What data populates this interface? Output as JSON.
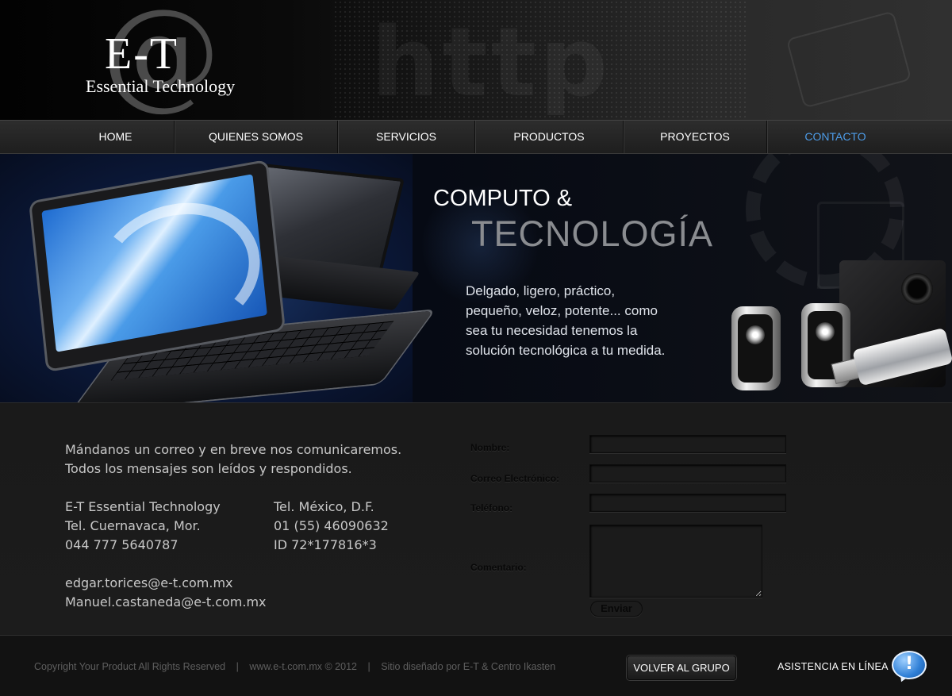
{
  "logo": {
    "at_symbol": "@",
    "initials": "E-T",
    "tagline": "Essential Technology"
  },
  "header_bg_word": "http",
  "nav": {
    "items": [
      {
        "label": "HOME",
        "active": false
      },
      {
        "label": "QUIENES SOMOS",
        "active": false
      },
      {
        "label": "SERVICIOS",
        "active": false
      },
      {
        "label": "PRODUCTOS",
        "active": false
      },
      {
        "label": "PROYECTOS",
        "active": false
      },
      {
        "label": "CONTACTO",
        "active": true
      }
    ],
    "active_color": "#4d9ce8"
  },
  "banner": {
    "title_line1": "COMPUTO &",
    "title_line2": "TECNOLOGÍA",
    "text_lines": [
      "Delgado, ligero, práctico,",
      "pequeño, veloz, potente... como",
      "sea tu necesidad tenemos la",
      "solución tecnológica a tu medida."
    ]
  },
  "contact": {
    "intro_line1": "Mándanos un correo y en breve nos comunicaremos.",
    "intro_line2": "Todos los mensajes son leídos y respondidos.",
    "col1": [
      "E-T  Essential Technology",
      "Tel. Cuernavaca, Mor.",
      "044 777 5640787"
    ],
    "col2": [
      "Tel. México, D.F.",
      "01 (55) 46090632",
      "ID 72*177816*3"
    ],
    "emails": [
      "edgar.torices@e-t.com.mx",
      "Manuel.castaneda@e-t.com.mx"
    ]
  },
  "form": {
    "name_label": "Nombre:",
    "email_label": "Correo Electrónico:",
    "phone_label": "Teléfono:",
    "comment_label": "Comentario:",
    "name_value": "",
    "email_value": "",
    "phone_value": "",
    "comment_value": "",
    "submit_label": "Enviar"
  },
  "footer": {
    "copyright": "Copyright Your Product All Rights Reserved",
    "site": "www.e-t.com.mx © 2012",
    "credits": "Sitio diseñado por E-T & Centro Ikasten",
    "separator": "|",
    "group_button": "VOLVER AL GRUPO",
    "assist_label": "ASISTENCIA EN LÍNEA",
    "assist_icon": "exclamation-bubble-icon",
    "assist_icon_glyph": "!"
  }
}
